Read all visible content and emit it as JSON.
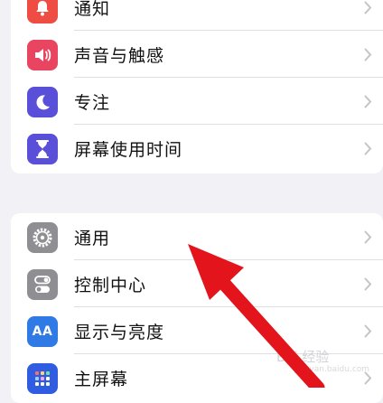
{
  "colors": {
    "notifications": "#ef4c43",
    "sounds": "#ea4560",
    "focus": "#5a4fd8",
    "screen_time": "#5a4fd8",
    "general": "#8e8e93",
    "control_center": "#8e8e93",
    "display": "#2f7ae5",
    "home_screen": "#2f5ce0",
    "arrow": "#e3141b"
  },
  "group1": {
    "items": [
      {
        "label": "通知",
        "icon": "bell-icon"
      },
      {
        "label": "声音与触感",
        "icon": "speaker-icon"
      },
      {
        "label": "专注",
        "icon": "moon-icon"
      },
      {
        "label": "屏幕使用时间",
        "icon": "hourglass-icon"
      }
    ]
  },
  "group2": {
    "items": [
      {
        "label": "通用",
        "icon": "gear-icon"
      },
      {
        "label": "控制中心",
        "icon": "toggles-icon"
      },
      {
        "label": "显示与亮度",
        "icon": "text-size-icon"
      },
      {
        "label": "主屏幕",
        "icon": "home-grid-icon"
      }
    ]
  },
  "icon_text": {
    "display": "AA"
  },
  "watermark": {
    "text": "Bai 经验",
    "sub": "jingyan.baidu.com"
  }
}
